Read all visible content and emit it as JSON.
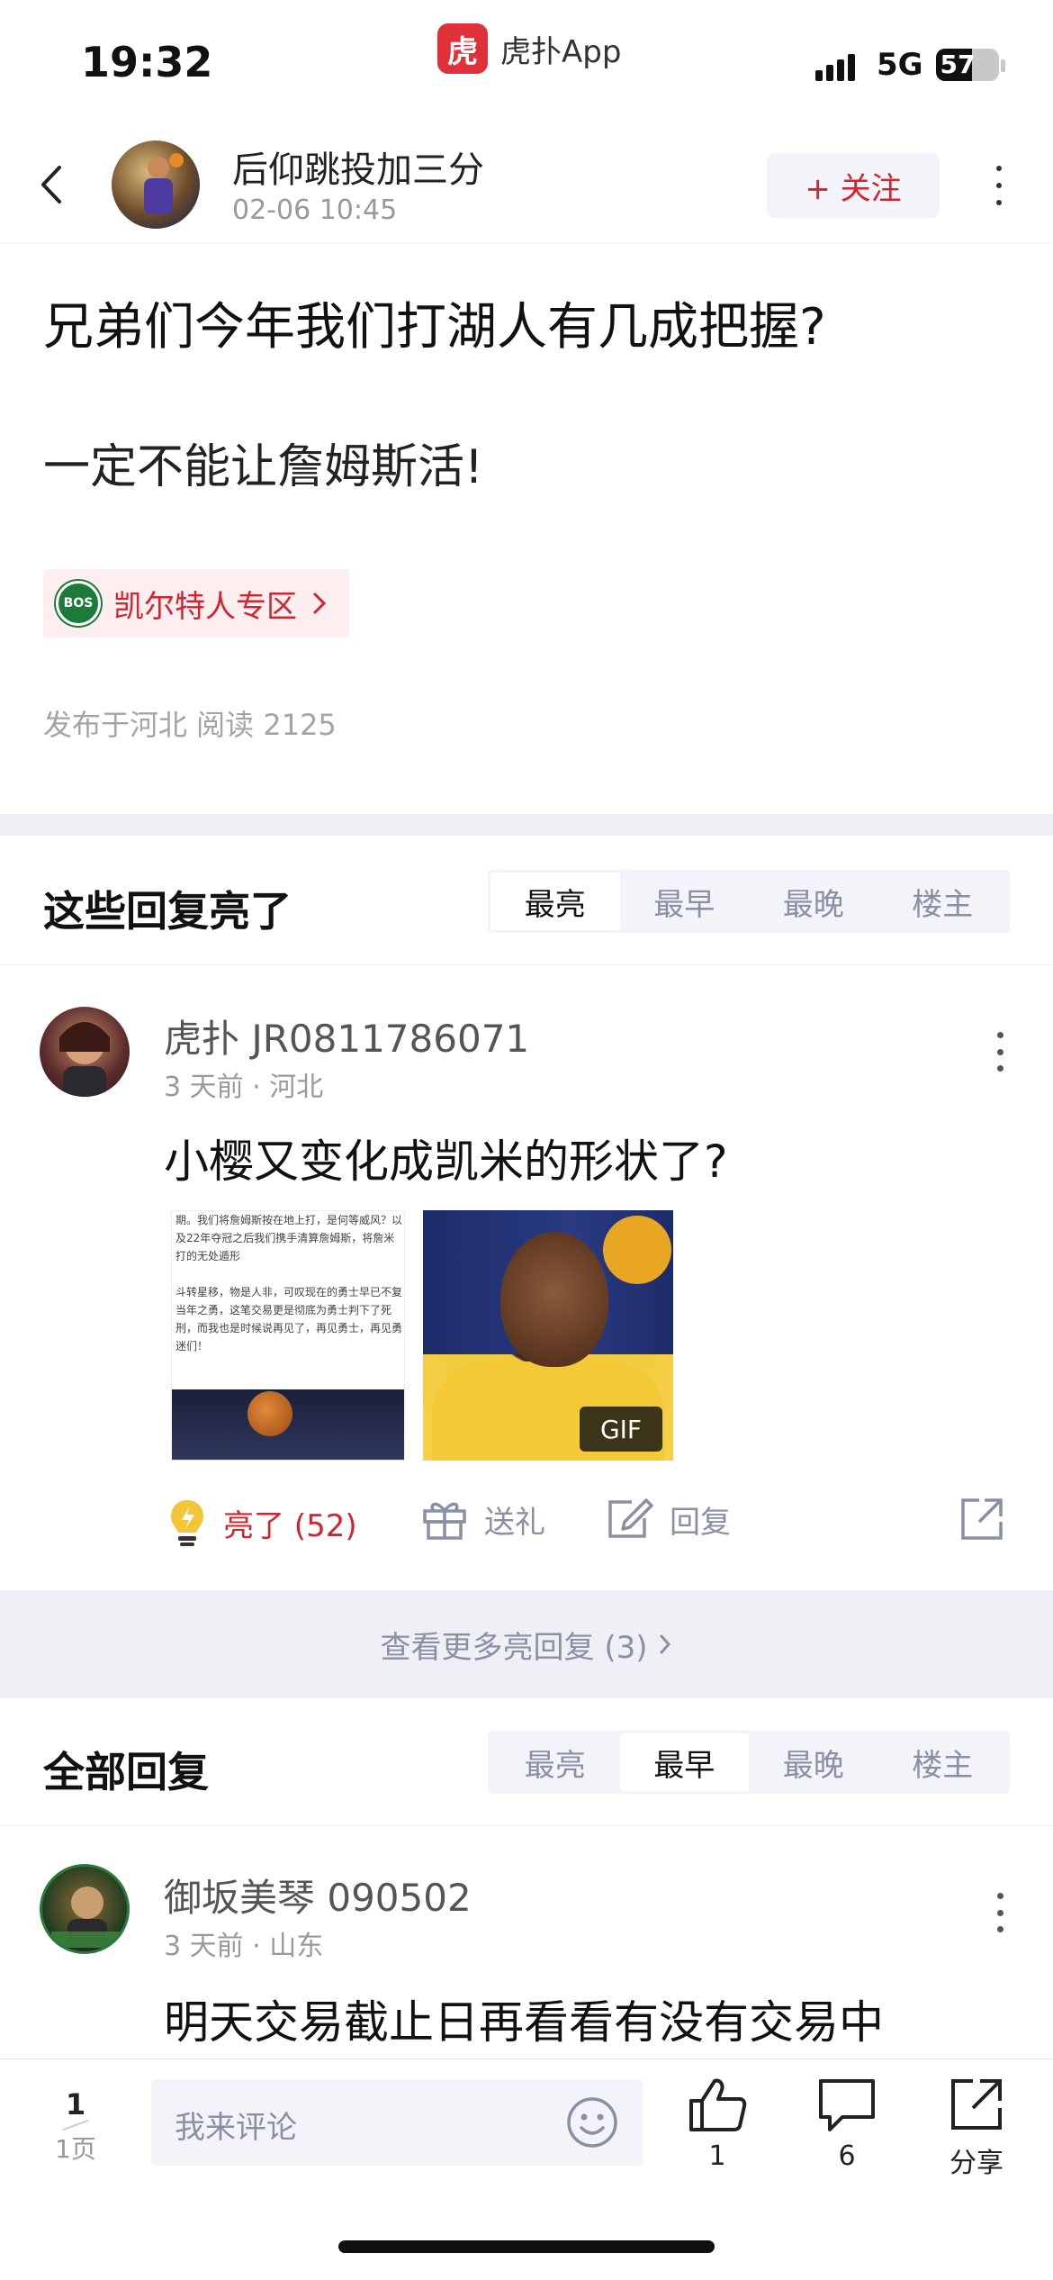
{
  "status_bar": {
    "time": "19:32",
    "network": "5G",
    "battery": "57",
    "battery_level": 0.57
  },
  "app_source": {
    "logo_char": "虎",
    "name": "虎扑App"
  },
  "header": {
    "author_name": "后仰跳投加三分",
    "post_time": "02-06 10:45",
    "follow_label": "+ 关注"
  },
  "post": {
    "title": "兄弟们今年我们打湖人有几成把握?",
    "body": "一定不能让詹姆斯活!",
    "zone_label": "凯尔特人专区",
    "zone_logo_text": "BOS",
    "meta": "发布于河北   阅读 2125"
  },
  "hot_section": {
    "title": "这些回复亮了",
    "tabs": [
      "最亮",
      "最早",
      "最晚",
      "楼主"
    ],
    "active_tab": 0
  },
  "hot_comment": {
    "author": "虎扑 JR0811786071",
    "meta": "3 天前 · 河北",
    "text": "小樱又变化成凯米的形状了?",
    "image_text": "期。我们将詹姆斯按在地上打，是何等威风？以及22年夺冠之后我们携手清算詹姆斯，将詹米打的无处遁形\n\n斗转星移，物是人非，可叹现在的勇士早已不复当年之勇，这笔交易更是彻底为勇士判下了死刑，而我也是时候说再见了，再见勇士，再见勇迷们！",
    "gif_label": "GIF",
    "like_label": "亮了 (52)",
    "gift_label": "送礼",
    "reply_label": "回复"
  },
  "more_hot": {
    "label": "查看更多亮回复 (3)"
  },
  "all_section": {
    "title": "全部回复",
    "tabs": [
      "最亮",
      "最早",
      "最晚",
      "楼主"
    ],
    "active_tab": 1
  },
  "first_reply": {
    "author": "御坂美琴 090502",
    "meta": "3 天前 · 山东",
    "text": "明天交易截止日再看看有没有交易中"
  },
  "bottom_bar": {
    "page_current": "1",
    "page_total": "1页",
    "comment_placeholder": "我来评论",
    "like_count": "1",
    "comment_count": "6",
    "share_label": "分享"
  },
  "colors": {
    "accent_red": "#d2232f",
    "muted": "#8a8fa3",
    "band": "#eef0f5"
  }
}
